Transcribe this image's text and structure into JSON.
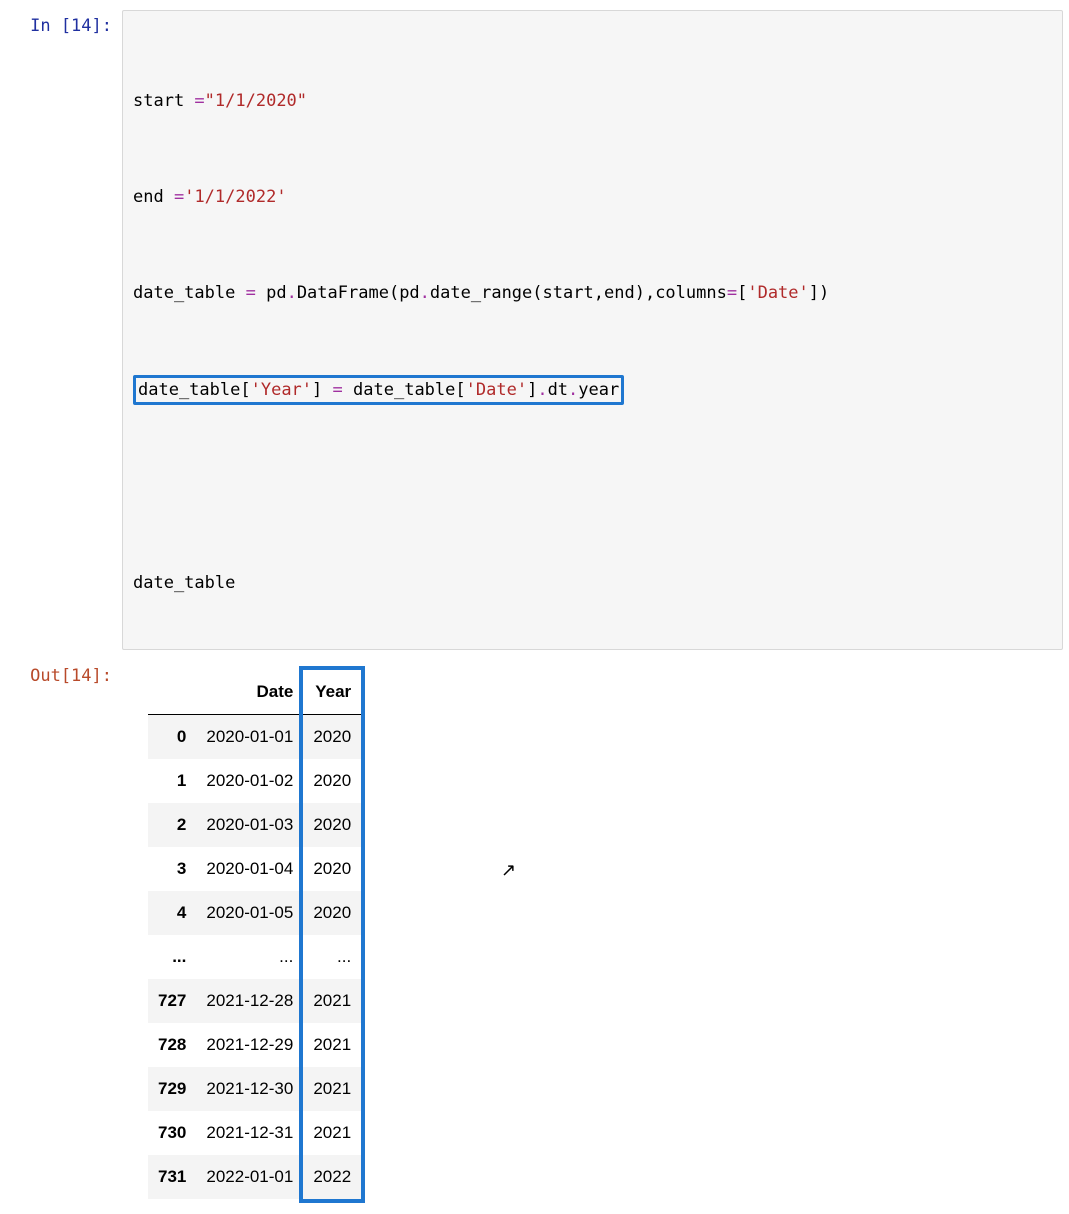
{
  "input": {
    "prompt": "In [14]:",
    "code": {
      "l1": {
        "a": "start ",
        "op1": "=",
        "s": "\"1/1/2020\""
      },
      "l2": {
        "a": "end ",
        "op1": "=",
        "s": "'1/1/2022'"
      },
      "l3": {
        "a": "date_table ",
        "op1": "=",
        "b": " pd",
        "dot1": ".",
        "fn1": "DataFrame",
        "open1": "(",
        "c": "pd",
        "dot2": ".",
        "fn2": "date_range",
        "open2": "(",
        "arg1": "start",
        "comma1": ",",
        "arg2": "end",
        "close2": ")",
        "comma2": ",",
        "kw": "columns",
        "op2": "=",
        "lb": "[",
        "str": "'Date'",
        "rb": "]",
        "close1": ")"
      },
      "l4": {
        "a": "date_table",
        "lb1": "[",
        "s1": "'Year'",
        "rb1": "]",
        "sp1": " ",
        "op": "=",
        "sp2": " ",
        "b": "date_table",
        "lb2": "[",
        "s2": "'Date'",
        "rb2": "]",
        "dot": ".",
        "attr1": "dt",
        "dot2": ".",
        "attr2": "year"
      },
      "l5": {
        "a": "date_table"
      }
    }
  },
  "output": {
    "prompt": "Out[14]:",
    "columns": [
      "",
      "Date",
      "Year"
    ],
    "rows": [
      {
        "idx": "0",
        "date": "2020-01-01",
        "year": "2020"
      },
      {
        "idx": "1",
        "date": "2020-01-02",
        "year": "2020"
      },
      {
        "idx": "2",
        "date": "2020-01-03",
        "year": "2020"
      },
      {
        "idx": "3",
        "date": "2020-01-04",
        "year": "2020"
      },
      {
        "idx": "4",
        "date": "2020-01-05",
        "year": "2020"
      },
      {
        "idx": "...",
        "date": "...",
        "year": "..."
      },
      {
        "idx": "727",
        "date": "2021-12-28",
        "year": "2021"
      },
      {
        "idx": "728",
        "date": "2021-12-29",
        "year": "2021"
      },
      {
        "idx": "729",
        "date": "2021-12-30",
        "year": "2021"
      },
      {
        "idx": "730",
        "date": "2021-12-31",
        "year": "2021"
      },
      {
        "idx": "731",
        "date": "2022-01-01",
        "year": "2022"
      }
    ]
  }
}
